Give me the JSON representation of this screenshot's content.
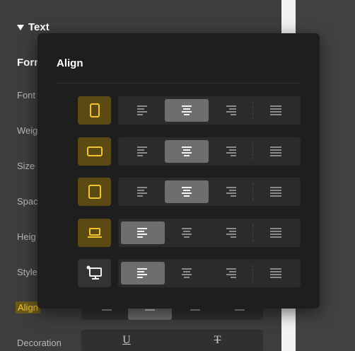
{
  "panel": {
    "section_title": "Text",
    "format_heading": "Forn",
    "labels": {
      "font": "Font",
      "weight": "Weig",
      "size": "Size",
      "spacing": "Spac",
      "height": "Heig",
      "style": "Style",
      "align": "Align",
      "decoration": "Decoration"
    },
    "decoration_glyphs": [
      "U",
      "T"
    ]
  },
  "popover": {
    "title": "Align",
    "rows": [
      {
        "device": "mobile-portrait-icon",
        "device_active": true,
        "selected": "center"
      },
      {
        "device": "mobile-landscape-icon",
        "device_active": true,
        "selected": "center"
      },
      {
        "device": "tablet-icon",
        "device_active": true,
        "selected": "center"
      },
      {
        "device": "laptop-icon",
        "device_active": true,
        "selected": "left"
      },
      {
        "device": "desktop-icon",
        "device_active": false,
        "selected": "left"
      }
    ],
    "options": [
      "left",
      "center",
      "right",
      "justify"
    ]
  },
  "colors": {
    "accent": "#f4c430",
    "accent_bg": "#5c4a14",
    "popover_bg": "#1e1e1e",
    "segment_active": "#6e6e6e"
  }
}
